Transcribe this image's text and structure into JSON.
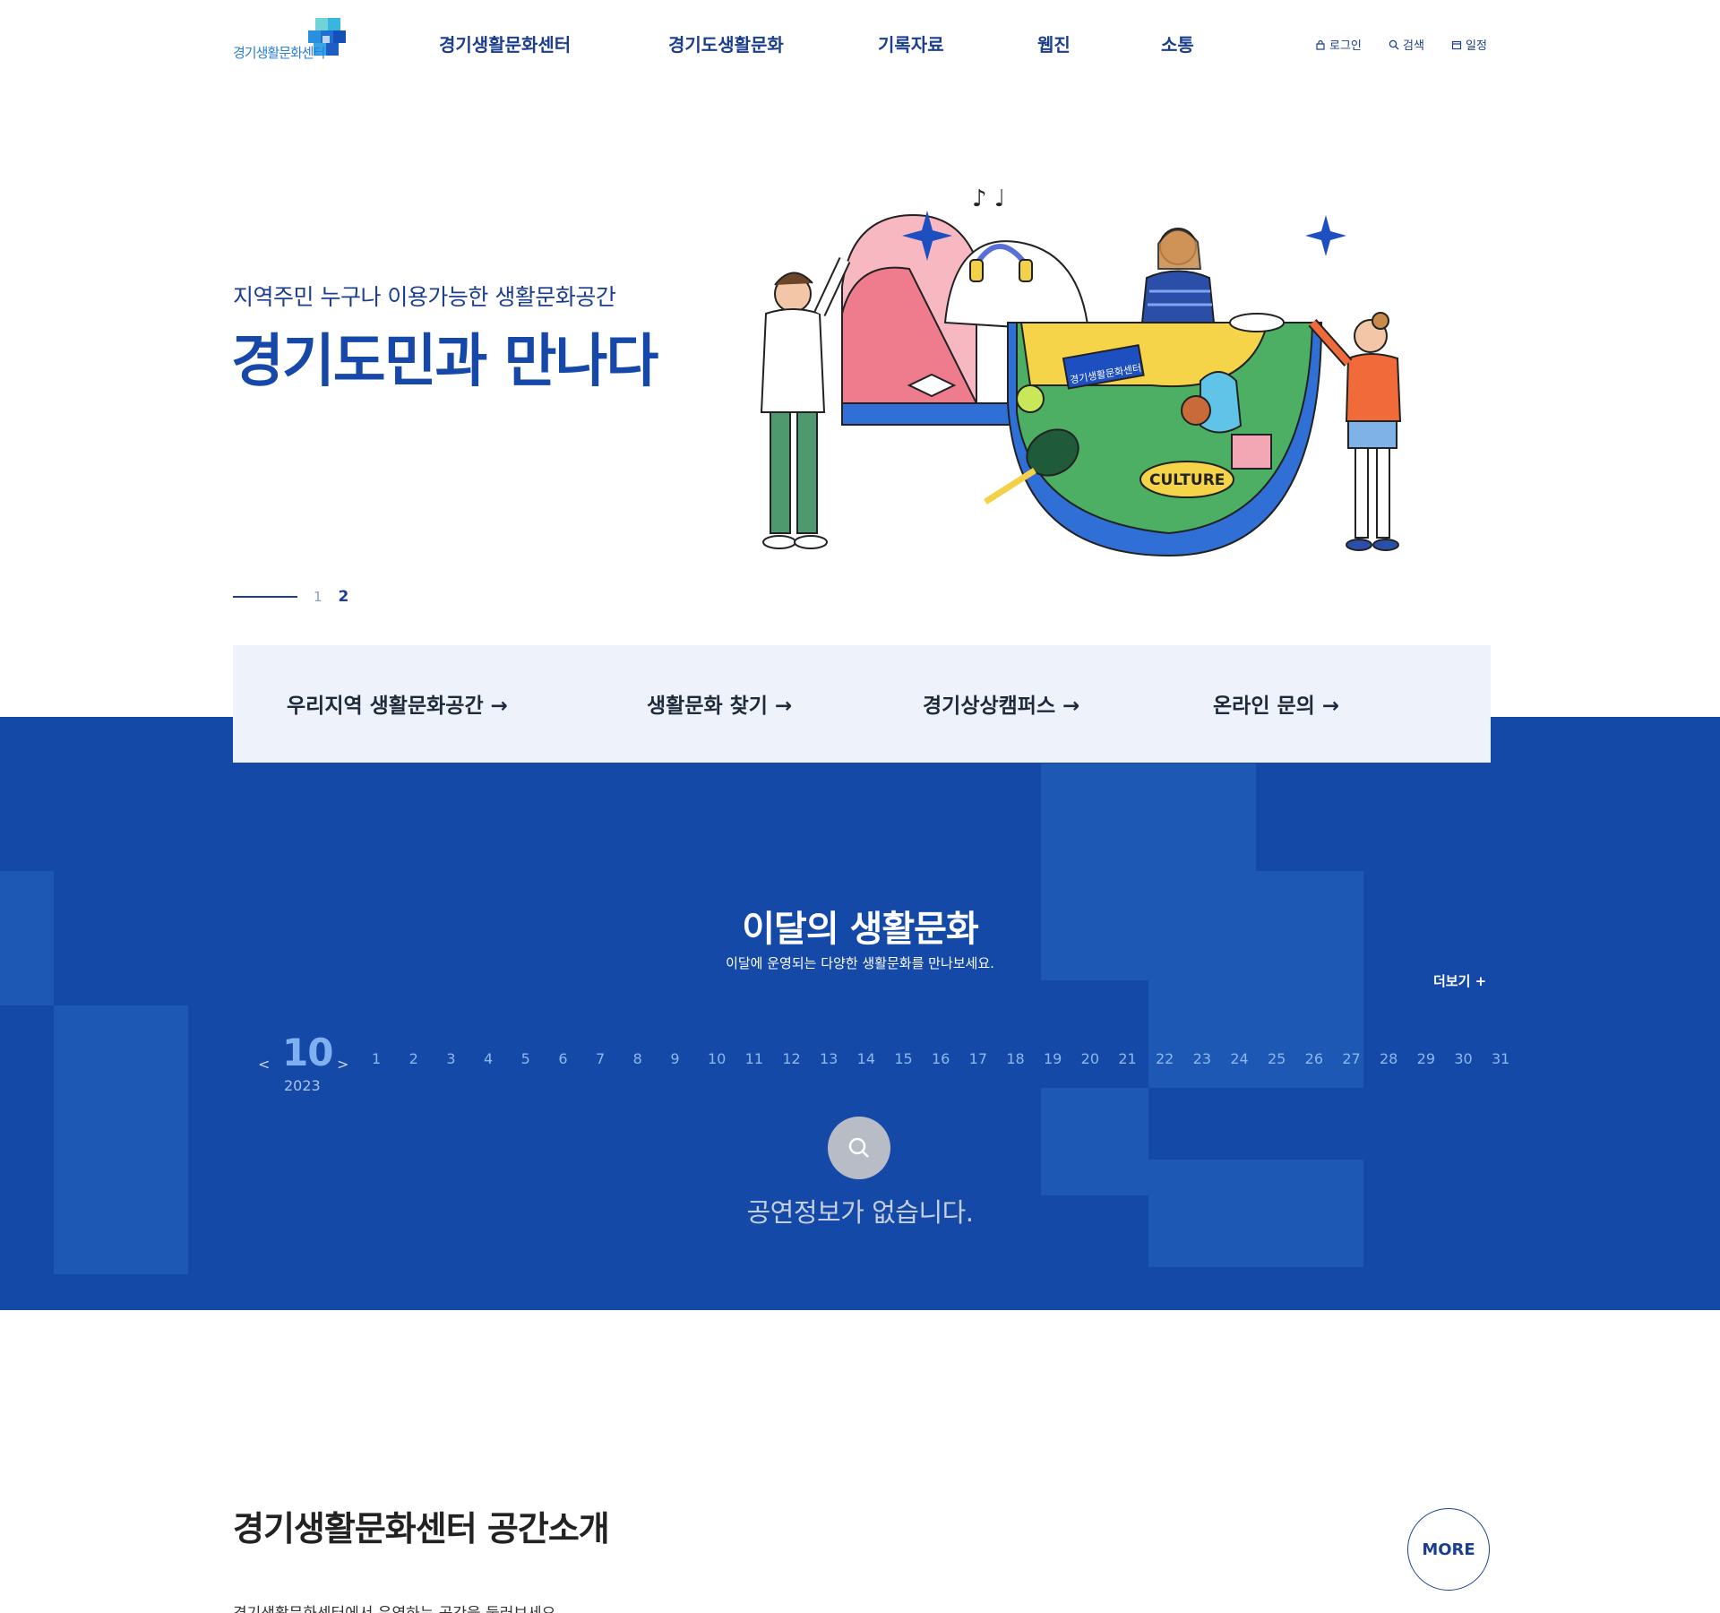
{
  "header": {
    "logo_text": "경기생활문화센터",
    "nav": [
      "경기생활문화센터",
      "경기도생활문화",
      "기록자료",
      "웹진",
      "소통"
    ],
    "utils": [
      {
        "icon": "lock-icon",
        "label": "로그인"
      },
      {
        "icon": "search-icon",
        "label": "검색"
      },
      {
        "icon": "calendar-icon",
        "label": "일정"
      }
    ]
  },
  "hero": {
    "subtitle": "지역주민 누구나 이용가능한 생활문화공간",
    "title": "경기도민과 만나다",
    "illustration_badge": "CULTURE",
    "illustration_flag": "경기생활문화센터",
    "pager": {
      "pages": [
        "1",
        "2"
      ],
      "current": "2"
    }
  },
  "quick_links": [
    "우리지역 생활문화공간 →",
    "생활문화 찾기 →",
    "경기상상캠퍼스 →",
    "온라인 문의 →"
  ],
  "monthly": {
    "title": "이달의 생활문화",
    "subtitle": "이달에 운영되는 다양한 생활문화를 만나보세요.",
    "more": "더보기 +",
    "calendar": {
      "prev": "<",
      "next": ">",
      "month": "10",
      "year": "2023",
      "days": [
        "1",
        "2",
        "3",
        "4",
        "5",
        "6",
        "7",
        "8",
        "9",
        "10",
        "11",
        "12",
        "13",
        "14",
        "15",
        "16",
        "17",
        "18",
        "19",
        "20",
        "21",
        "22",
        "23",
        "24",
        "25",
        "26",
        "27",
        "28",
        "29",
        "30",
        "31"
      ]
    },
    "empty_message": "공연정보가 없습니다."
  },
  "space": {
    "title": "경기생활문화센터 공간소개",
    "description": "경기생활문화센터에서 운영하는 공간을 둘러보세요.",
    "more": "MORE"
  },
  "colors": {
    "primary": "#1449a8",
    "navy": "#1b3e8f",
    "quick_bg": "#eef3fb"
  }
}
